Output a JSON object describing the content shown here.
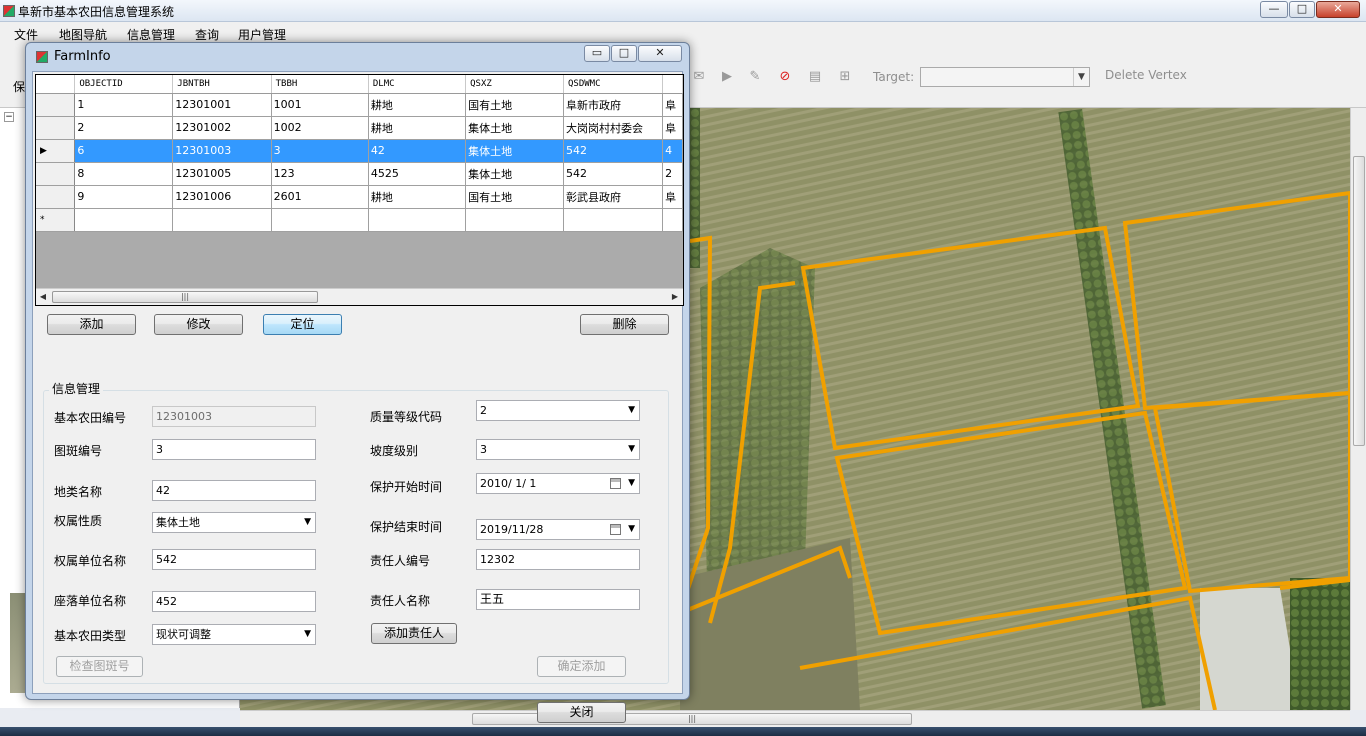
{
  "app": {
    "title": "阜新市基本农田信息管理系统",
    "window_controls": {
      "minimize": "—",
      "maximize": "□",
      "close": "✕"
    }
  },
  "menu": {
    "items": [
      "文件",
      "地图导航",
      "信息管理",
      "查询",
      "用户管理"
    ]
  },
  "toolbar": {
    "save_partial": "保",
    "target_label": "Target:",
    "target_value": "",
    "delete_vertex": "Delete Vertex"
  },
  "map": {
    "parcel_outline_color": "#f0a000"
  },
  "dialog": {
    "title": "FarmInfo",
    "controls": {
      "minimize": "▭",
      "maximize": "□",
      "close": "✕"
    },
    "grid": {
      "columns": [
        "OBJECTID",
        "JBNTBH",
        "TBBH",
        "DLMC",
        "QSXZ",
        "QSDWMC",
        ""
      ],
      "rows": [
        {
          "marker": "",
          "cells": [
            "1",
            "12301001",
            "1001",
            "耕地",
            "国有土地",
            "阜新市政府",
            "阜"
          ]
        },
        {
          "marker": "",
          "cells": [
            "2",
            "12301002",
            "1002",
            "耕地",
            "集体土地",
            "大岗岗村村委会",
            "阜"
          ]
        },
        {
          "marker": "▶",
          "cells": [
            "6",
            "12301003",
            "3",
            "42",
            "集体土地",
            "542",
            "4"
          ]
        },
        {
          "marker": "",
          "cells": [
            "8",
            "12301005",
            "123",
            "4525",
            "集体土地",
            "542",
            "2"
          ]
        },
        {
          "marker": "",
          "cells": [
            "9",
            "12301006",
            "2601",
            "耕地",
            "国有土地",
            "彰武县政府",
            "阜"
          ]
        },
        {
          "marker": "*",
          "cells": [
            "",
            "",
            "",
            "",
            "",
            "",
            ""
          ]
        }
      ],
      "selected_index": 2,
      "scroll_grip": "|||",
      "scroll_left": "◀",
      "scroll_right": "▶"
    },
    "buttons": {
      "add": "添加",
      "edit": "修改",
      "locate": "定位",
      "delete": "删除",
      "check_patch": "检查图斑号",
      "add_person": "添加责任人",
      "confirm_add": "确定添加",
      "close": "关闭"
    },
    "group_title": "信息管理",
    "form": {
      "farm_no_label": "基本农田编号",
      "farm_no": "12301003",
      "patch_no_label": "图斑编号",
      "patch_no": "3",
      "land_class_label": "地类名称",
      "land_class": "42",
      "ownership_label": "权属性质",
      "ownership": "集体土地",
      "owner_unit_label": "权属单位名称",
      "owner_unit": "542",
      "located_unit_label": "座落单位名称",
      "located_unit": "452",
      "farm_type_label": "基本农田类型",
      "farm_type": "现状可调整",
      "quality_label": "质量等级代码",
      "quality": "2",
      "slope_label": "坡度级别",
      "slope": "3",
      "start_label": "保护开始时间",
      "start": "2010/ 1/ 1",
      "end_label": "保护结束时间",
      "end": "2019/11/28",
      "person_no_label": "责任人编号",
      "person_no": "12302",
      "person_name_label": "责任人名称",
      "person_name": "王五"
    }
  }
}
